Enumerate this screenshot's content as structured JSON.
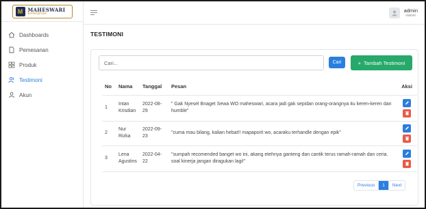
{
  "brand": {
    "name": "MAHESWARI",
    "sub": "Enterprise",
    "mark": "M"
  },
  "user": {
    "name": "admin",
    "role": "owner"
  },
  "nav": [
    {
      "label": "Dashboards",
      "icon": "home-icon"
    },
    {
      "label": "Pemesanan",
      "icon": "document-icon"
    },
    {
      "label": "Produk",
      "icon": "grid-icon"
    },
    {
      "label": "Testimoni",
      "icon": "users-icon"
    },
    {
      "label": "Akun",
      "icon": "user-icon"
    }
  ],
  "page": {
    "title": "TESTIMONI"
  },
  "search": {
    "placeholder": "Cari...",
    "value": "",
    "button_label": "Cari"
  },
  "add_button": {
    "label": "Tambah Testimoni",
    "icon": "+"
  },
  "table": {
    "headers": {
      "no": "No",
      "nama": "Nama",
      "tanggal": "Tanggal",
      "pesan": "Pesan",
      "aksi": "Aksi"
    },
    "rows": [
      {
        "no": "1",
        "nama": "Intan Krisdian",
        "tanggal": "2022-08-29",
        "pesan": "\" Gak Nyesel Bnaget Sewa WO maheswari, acara jadi gak sepidan orang-orangnya itu keren-keren dan humble\""
      },
      {
        "no": "2",
        "nama": "Nur Rizka",
        "tanggal": "2022-09-23",
        "pesan": "\"cuma mau bilang, kalian hebat!! mapaporit wo, acaraku terhandle dengan epik\""
      },
      {
        "no": "3",
        "nama": "Lena Agustins",
        "tanggal": "2022-04-22",
        "pesan": "\"sumpah recomended banget wo ini, akang etehnya ganteng dan cantik terus ramah-ramah dan ceria. soal kinerja jangan diragukan lagi!\""
      }
    ]
  },
  "pagination": {
    "previous": "Previous",
    "current": "1",
    "next": "Next"
  },
  "colors": {
    "primary": "#2a7ee0",
    "success": "#27a96b",
    "danger": "#ea5a45",
    "active_nav": "#2a7ee0"
  }
}
